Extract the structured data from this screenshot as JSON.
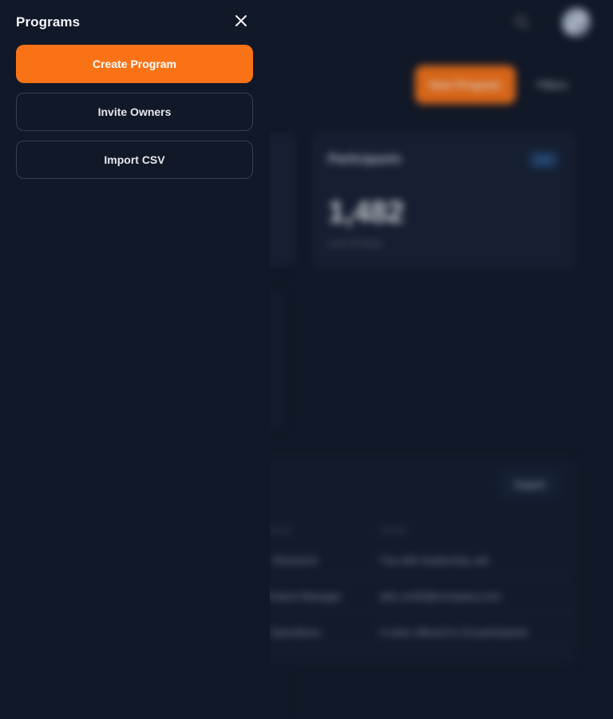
{
  "drawer": {
    "title": "Programs",
    "close_icon": "close-icon",
    "actions": [
      {
        "label": "Create Program",
        "style": "primary"
      },
      {
        "label": "Invite Owners",
        "style": "outline"
      },
      {
        "label": "Import CSV",
        "style": "outline"
      }
    ]
  },
  "background": {
    "header": {
      "search_icon": "search-icon",
      "avatar": "user-avatar"
    },
    "toolbar": {
      "primary_button": "New Program",
      "secondary_button": "Filters"
    },
    "stat_card": {
      "title": "Participants",
      "badge": "Live",
      "value": "1,482",
      "subtitle": "Last 30 days"
    },
    "table": {
      "export_label": "Export",
      "headers": [
        "Name",
        "Details"
      ],
      "rows": [
        {
          "name": "Research",
          "details": "Tue with leadership call"
        },
        {
          "name": "Product Manager",
          "details": "alex.smith@company.com"
        },
        {
          "name": "Operations",
          "details": "3 roles offered to 24 participants"
        }
      ]
    }
  },
  "colors": {
    "accent": "#f97316",
    "background": "#111827",
    "border": "#334155",
    "text": "#f3f4f6"
  }
}
